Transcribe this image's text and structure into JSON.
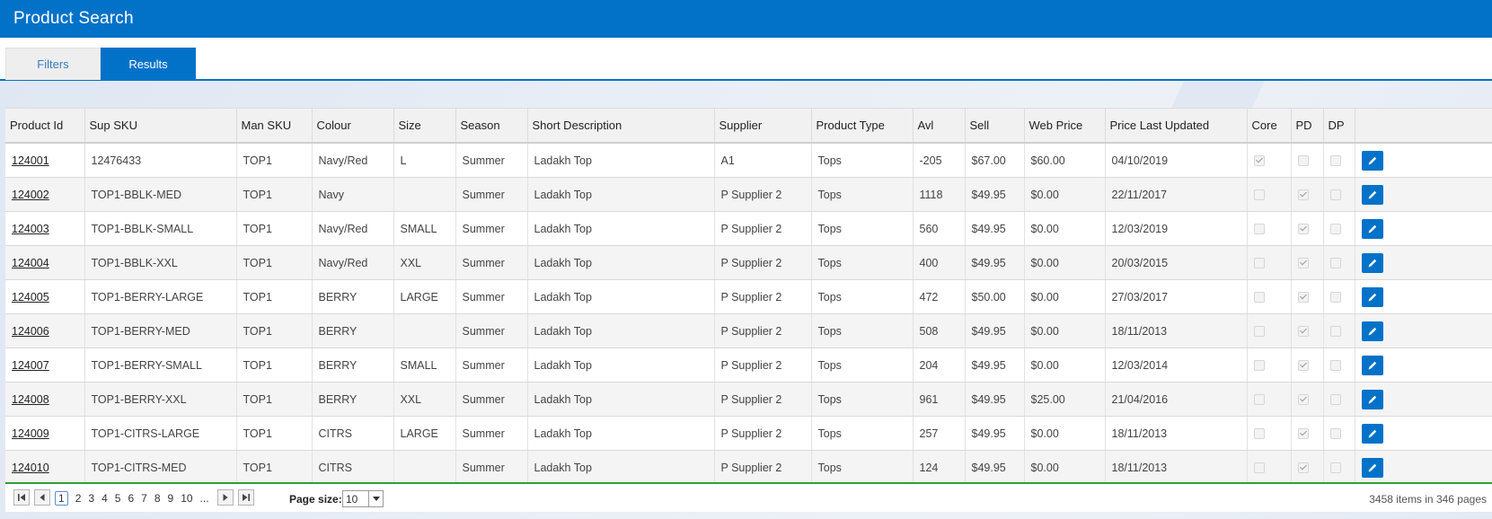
{
  "header": {
    "title": "Product Search"
  },
  "tabs": [
    {
      "label": "Filters"
    },
    {
      "label": "Results"
    }
  ],
  "table": {
    "columns": [
      "Product Id",
      "Sup SKU",
      "Man SKU",
      "Colour",
      "Size",
      "Season",
      "Short Description",
      "Supplier",
      "Product Type",
      "Avl",
      "Sell",
      "Web Price",
      "Price Last Updated",
      "Core",
      "PD",
      "DP"
    ],
    "rows": [
      {
        "id": "124001",
        "sup_sku": "12476433",
        "man_sku": "TOP1",
        "colour": "Navy/Red",
        "size": "L",
        "season": "Summer",
        "desc": "Ladakh Top",
        "supplier": "A1",
        "type": "Tops",
        "avl": "-205",
        "sell": "$67.00",
        "web_price": "$60.00",
        "updated": "04/10/2019",
        "core": true,
        "pd": false,
        "dp": false
      },
      {
        "id": "124002",
        "sup_sku": "TOP1-BBLK-MED",
        "man_sku": "TOP1",
        "colour": "Navy",
        "size": "",
        "season": "Summer",
        "desc": "Ladakh Top",
        "supplier": "P Supplier 2",
        "type": "Tops",
        "avl": "1118",
        "sell": "$49.95",
        "web_price": "$0.00",
        "updated": "22/11/2017",
        "core": false,
        "pd": true,
        "dp": false
      },
      {
        "id": "124003",
        "sup_sku": "TOP1-BBLK-SMALL",
        "man_sku": "TOP1",
        "colour": "Navy/Red",
        "size": "SMALL",
        "season": "Summer",
        "desc": "Ladakh Top",
        "supplier": "P Supplier 2",
        "type": "Tops",
        "avl": "560",
        "sell": "$49.95",
        "web_price": "$0.00",
        "updated": "12/03/2019",
        "core": false,
        "pd": true,
        "dp": false
      },
      {
        "id": "124004",
        "sup_sku": "TOP1-BBLK-XXL",
        "man_sku": "TOP1",
        "colour": "Navy/Red",
        "size": "XXL",
        "season": "Summer",
        "desc": "Ladakh Top",
        "supplier": "P Supplier 2",
        "type": "Tops",
        "avl": "400",
        "sell": "$49.95",
        "web_price": "$0.00",
        "updated": "20/03/2015",
        "core": false,
        "pd": true,
        "dp": false
      },
      {
        "id": "124005",
        "sup_sku": "TOP1-BERRY-LARGE",
        "man_sku": "TOP1",
        "colour": "BERRY",
        "size": "LARGE",
        "season": "Summer",
        "desc": "Ladakh Top",
        "supplier": "P Supplier 2",
        "type": "Tops",
        "avl": "472",
        "sell": "$50.00",
        "web_price": "$0.00",
        "updated": "27/03/2017",
        "core": false,
        "pd": true,
        "dp": false
      },
      {
        "id": "124006",
        "sup_sku": "TOP1-BERRY-MED",
        "man_sku": "TOP1",
        "colour": "BERRY",
        "size": "",
        "season": "Summer",
        "desc": "Ladakh Top",
        "supplier": "P Supplier 2",
        "type": "Tops",
        "avl": "508",
        "sell": "$49.95",
        "web_price": "$0.00",
        "updated": "18/11/2013",
        "core": false,
        "pd": true,
        "dp": false
      },
      {
        "id": "124007",
        "sup_sku": "TOP1-BERRY-SMALL",
        "man_sku": "TOP1",
        "colour": "BERRY",
        "size": "SMALL",
        "season": "Summer",
        "desc": "Ladakh Top",
        "supplier": "P Supplier 2",
        "type": "Tops",
        "avl": "204",
        "sell": "$49.95",
        "web_price": "$0.00",
        "updated": "12/03/2014",
        "core": false,
        "pd": true,
        "dp": false
      },
      {
        "id": "124008",
        "sup_sku": "TOP1-BERRY-XXL",
        "man_sku": "TOP1",
        "colour": "BERRY",
        "size": "XXL",
        "season": "Summer",
        "desc": "Ladakh Top",
        "supplier": "P Supplier 2",
        "type": "Tops",
        "avl": "961",
        "sell": "$49.95",
        "web_price": "$25.00",
        "updated": "21/04/2016",
        "core": false,
        "pd": true,
        "dp": false
      },
      {
        "id": "124009",
        "sup_sku": "TOP1-CITRS-LARGE",
        "man_sku": "TOP1",
        "colour": "CITRS",
        "size": "LARGE",
        "season": "Summer",
        "desc": "Ladakh Top",
        "supplier": "P Supplier 2",
        "type": "Tops",
        "avl": "257",
        "sell": "$49.95",
        "web_price": "$0.00",
        "updated": "18/11/2013",
        "core": false,
        "pd": true,
        "dp": false
      },
      {
        "id": "124010",
        "sup_sku": "TOP1-CITRS-MED",
        "man_sku": "TOP1",
        "colour": "CITRS",
        "size": "",
        "season": "Summer",
        "desc": "Ladakh Top",
        "supplier": "P Supplier 2",
        "type": "Tops",
        "avl": "124",
        "sell": "$49.95",
        "web_price": "$0.00",
        "updated": "18/11/2013",
        "core": false,
        "pd": true,
        "dp": false
      }
    ]
  },
  "pager": {
    "pages": [
      "1",
      "2",
      "3",
      "4",
      "5",
      "6",
      "7",
      "8",
      "9",
      "10",
      "..."
    ],
    "current": "1",
    "page_size_label": "Page size:",
    "page_size": "10",
    "info": "3458 items in 346 pages"
  },
  "colors": {
    "brand": "#0272c9",
    "pager_border": "#2e9e3a"
  },
  "icons": [
    "first-page-icon",
    "prev-page-icon",
    "next-page-icon",
    "last-page-icon",
    "pencil-icon",
    "chevron-down-icon",
    "checkmark-icon"
  ]
}
